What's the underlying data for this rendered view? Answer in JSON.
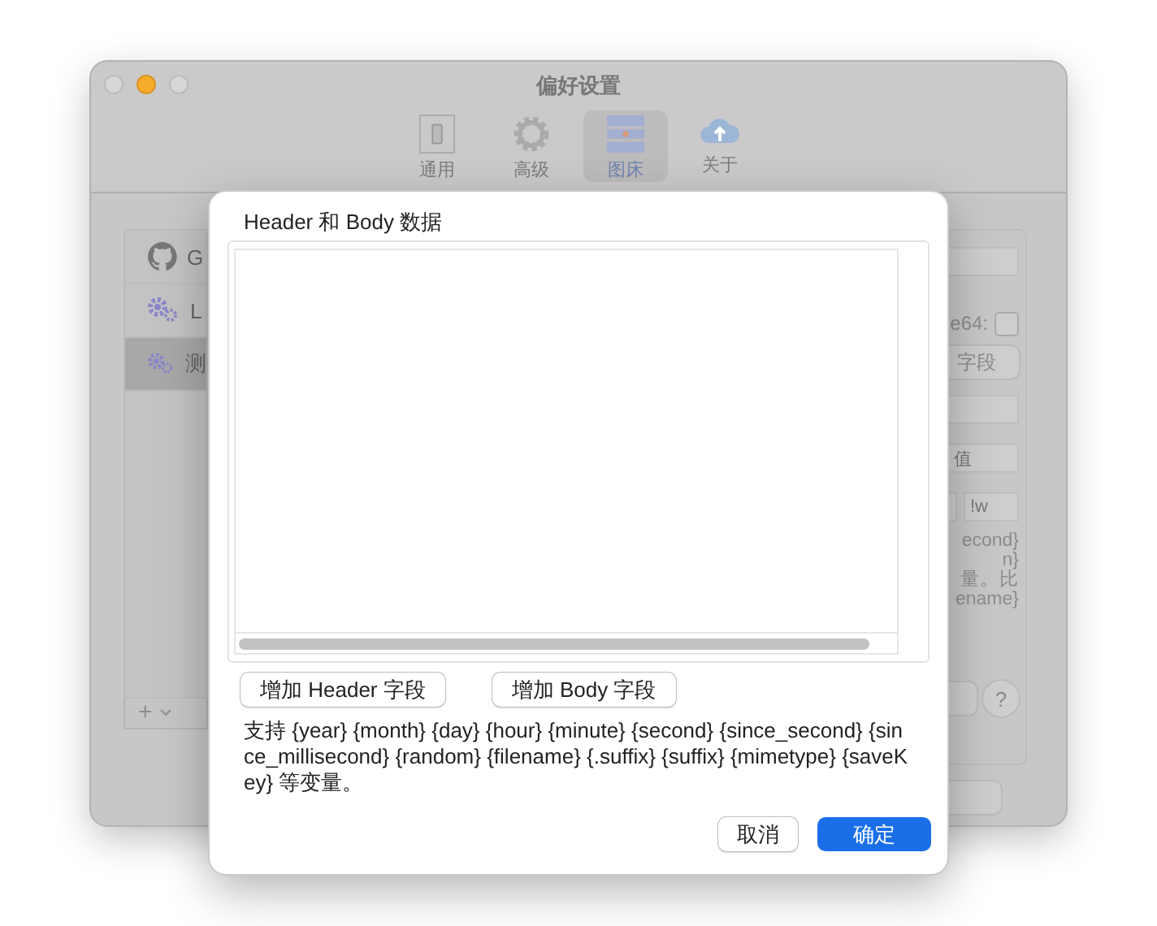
{
  "window": {
    "title": "偏好设置"
  },
  "toolbar": [
    {
      "label": "通用",
      "kind": "general",
      "selected": false
    },
    {
      "label": "高级",
      "kind": "advanced",
      "selected": false
    },
    {
      "label": "图床",
      "kind": "hosting",
      "selected": true
    },
    {
      "label": "关于",
      "kind": "about",
      "selected": false
    }
  ],
  "sidebar": {
    "items": [
      {
        "label": "G",
        "kind": "github",
        "selected": false
      },
      {
        "label": "L",
        "kind": "gears",
        "selected": false
      },
      {
        "label": "测",
        "kind": "gears",
        "selected": true
      }
    ],
    "add_button": "+"
  },
  "panel": {
    "checkbox": {
      "label": "e64:",
      "checked": false
    },
    "field_button": "字段",
    "value_placeholder": "值",
    "short_field_value": "!w",
    "hint_lines": [
      "econd}",
      "n}",
      "量。比",
      "ename}"
    ],
    "help_button": "?"
  },
  "sheet": {
    "title": "Header 和 Body 数据",
    "buttons": [
      "增加 Header 字段",
      "增加 Body 字段"
    ],
    "hint": "支持 {year} {month} {day} {hour} {minute} {second} {since_second} {since_millisecond} {random} {filename} {.suffix} {suffix} {mimetype} {saveKey} 等变量。",
    "cancel": "取消",
    "confirm": "确定"
  }
}
